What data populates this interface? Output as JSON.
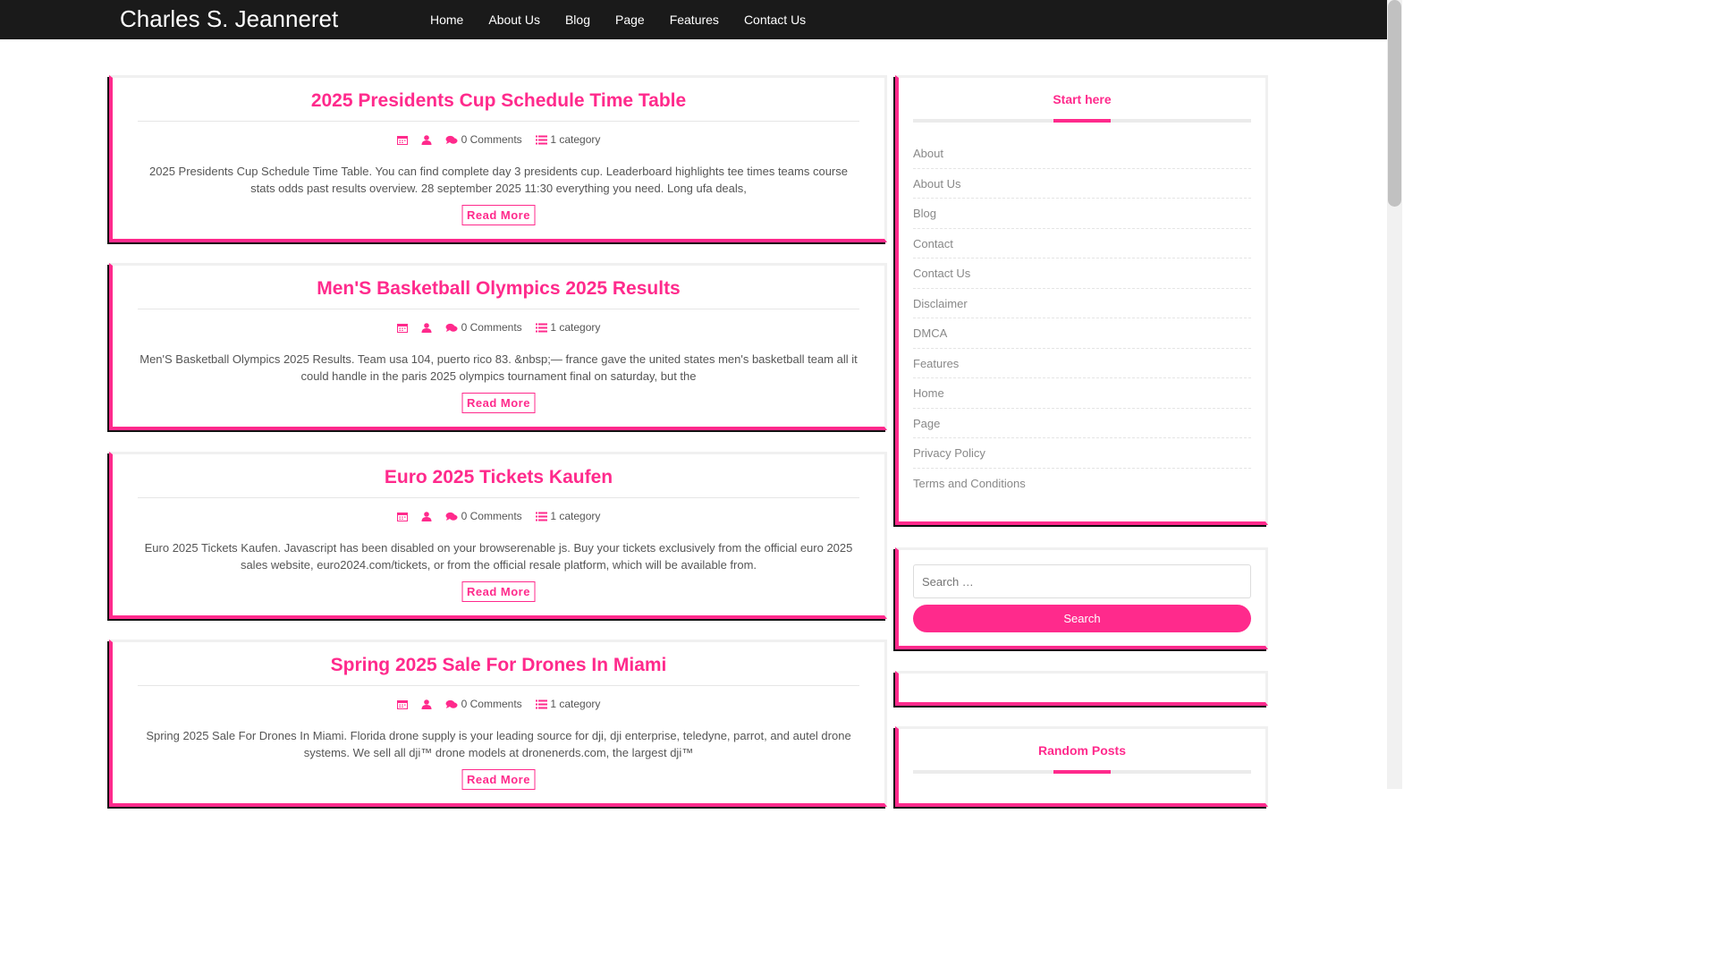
{
  "header": {
    "site_title": "Charles S. Jeanneret",
    "nav": [
      "Home",
      "About Us",
      "Blog",
      "Page",
      "Features",
      "Contact Us"
    ]
  },
  "posts": [
    {
      "title": "2025 Presidents Cup Schedule Time Table",
      "comments": "0 Comments",
      "category": "1 category",
      "excerpt": "2025 Presidents Cup Schedule Time Table. You can find complete day 3 presidents cup. Leaderboard highlights tee times teams course stats odds past results overview. 28 september 2025 11:30 everything you need. Long ufa deals,",
      "read_more": "Read More"
    },
    {
      "title": "Men'S Basketball Olympics 2025 Results",
      "comments": "0 Comments",
      "category": "1 category",
      "excerpt": "Men'S Basketball Olympics 2025 Results. Team usa 104, puerto rico 83. &nbsp;— france gave the united states men's basketball team all it could handle in the paris 2025 olympics tournament final on saturday, but the",
      "read_more": "Read More"
    },
    {
      "title": "Euro 2025 Tickets Kaufen",
      "comments": "0 Comments",
      "category": "1 category",
      "excerpt": "Euro 2025 Tickets Kaufen. Javascript has been disabled on your browserenable js. Buy your tickets exclusively from the official euro 2025 sales website, euro2024.com/tickets, or from the official resale platform, which will be available from.",
      "read_more": "Read More"
    },
    {
      "title": "Spring 2025 Sale For Drones In Miami",
      "comments": "0 Comments",
      "category": "1 category",
      "excerpt": "Spring 2025 Sale For Drones In Miami. Florida drone supply is your leading source for dji, dji enterprise, teledyne, parrot, and autel drone systems. We sell all dji™ drone models at dronenerds.com, the largest dji™",
      "read_more": "Read More"
    }
  ],
  "sidebar": {
    "start_here": {
      "title": "Start here",
      "pages": [
        "About",
        "About Us",
        "Blog",
        "Contact",
        "Contact Us",
        "Disclaimer",
        "DMCA",
        "Features",
        "Home",
        "Page",
        "Privacy Policy",
        "Terms and Conditions"
      ]
    },
    "search": {
      "placeholder": "Search …",
      "button": "Search"
    },
    "random_posts": {
      "title": "Random Posts"
    }
  },
  "colors": {
    "accent": "#ff2a8c",
    "header_bg": "#1a1a1a"
  },
  "icons": [
    "calendar-icon",
    "user-icon",
    "comments-icon",
    "list-icon"
  ]
}
